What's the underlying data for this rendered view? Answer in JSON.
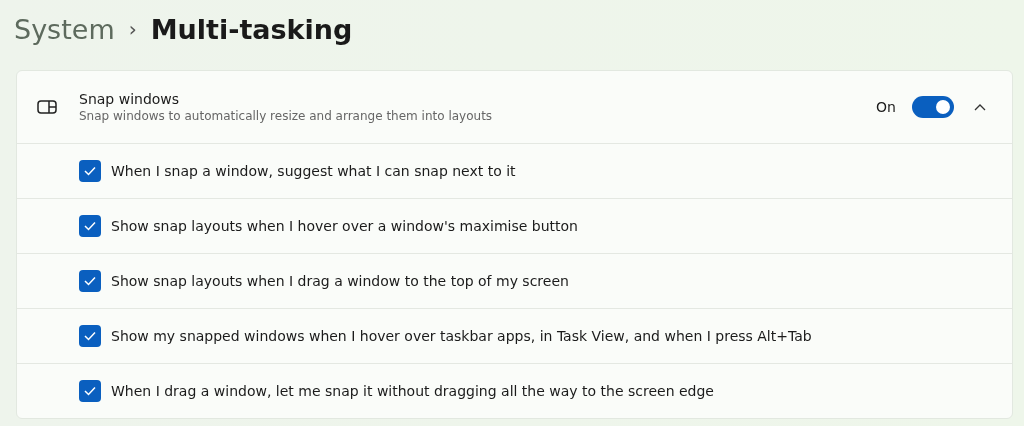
{
  "breadcrumb": {
    "parent": "System",
    "separator": "›",
    "current": "Multi-tasking"
  },
  "snap_windows": {
    "title": "Snap windows",
    "description": "Snap windows to automatically resize and arrange them into layouts",
    "state_label": "On",
    "on": true,
    "expanded": true,
    "options": [
      {
        "label": "When I snap a window, suggest what I can snap next to it",
        "checked": true
      },
      {
        "label": "Show snap layouts when I hover over a window's maximise button",
        "checked": true
      },
      {
        "label": "Show snap layouts when I drag a window to the top of my screen",
        "checked": true
      },
      {
        "label": "Show my snapped windows when I hover over taskbar apps, in Task View, and when I press Alt+Tab",
        "checked": true
      },
      {
        "label": "When I drag a window, let me snap it without dragging all the way to the screen edge",
        "checked": true
      }
    ]
  }
}
